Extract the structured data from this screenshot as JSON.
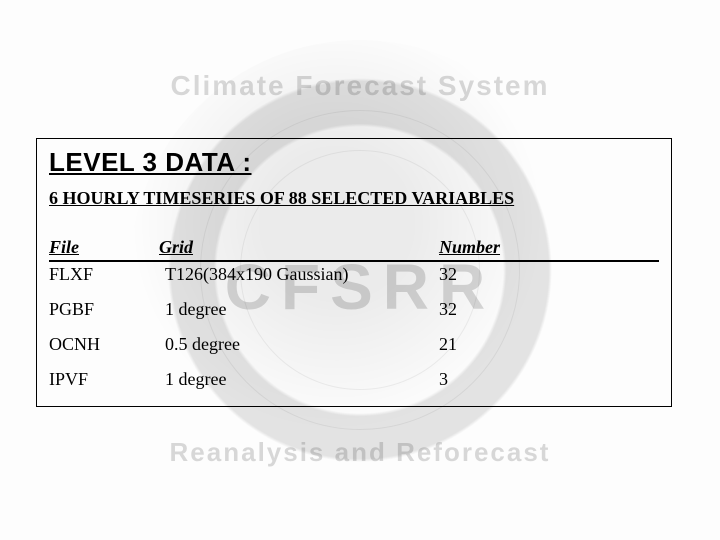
{
  "watermark": {
    "top_text": "Climate Forecast System",
    "center_text": "CFSRR",
    "bottom_text": "Reanalysis and Reforecast"
  },
  "card": {
    "title": "LEVEL 3 DATA :",
    "subtitle": "6 HOURLY TIMESERIES OF 88 SELECTED VARIABLES",
    "headers": {
      "file": "File",
      "grid": "Grid",
      "number": "Number"
    },
    "rows": [
      {
        "file": "FLXF",
        "grid": "T126(384x190 Gaussian)",
        "number": "32"
      },
      {
        "file": "PGBF",
        "grid": "1 degree",
        "number": "32"
      },
      {
        "file": "OCNH",
        "grid": "0.5 degree",
        "number": "21"
      },
      {
        "file": "IPVF",
        "grid": "1 degree",
        "number": "3"
      }
    ]
  },
  "chart_data": {
    "type": "table",
    "title": "LEVEL 3 DATA : 6 HOURLY TIMESERIES OF 88 SELECTED VARIABLES",
    "columns": [
      "File",
      "Grid",
      "Number"
    ],
    "rows": [
      [
        "FLXF",
        "T126(384x190 Gaussian)",
        32
      ],
      [
        "PGBF",
        "1 degree",
        32
      ],
      [
        "OCNH",
        "0.5 degree",
        21
      ],
      [
        "IPVF",
        "1 degree",
        3
      ]
    ]
  }
}
